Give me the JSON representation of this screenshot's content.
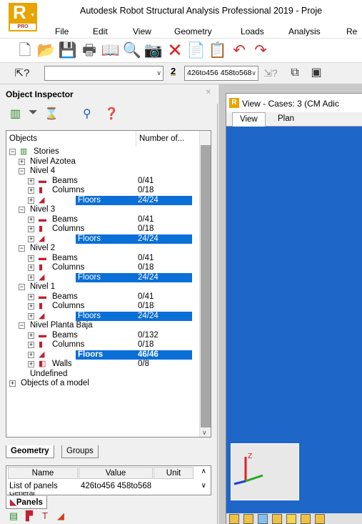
{
  "window": {
    "title": "Autodesk Robot Structural Analysis Professional 2019 - Proje",
    "logo_letter": "R",
    "logo_badge": "PRO"
  },
  "menu": [
    "File",
    "Edit",
    "View",
    "Geometry",
    "Loads",
    "Analysis",
    "Re"
  ],
  "toolbar2": {
    "combo1_value": "",
    "layer_number": "2",
    "selection_value": "426to456 458to568"
  },
  "inspector": {
    "title": "Object Inspector",
    "columns": [
      "Objects",
      "Number of..."
    ],
    "tree": [
      {
        "level": 0,
        "exp": "minus",
        "icon": "stories-icon",
        "label": "Stories",
        "count": ""
      },
      {
        "level": 1,
        "exp": "plus",
        "icon": "",
        "label": "Nivel Azotea",
        "count": ""
      },
      {
        "level": 1,
        "exp": "minus",
        "icon": "",
        "label": "Nivel 4",
        "count": ""
      },
      {
        "level": 2,
        "exp": "plus",
        "icon": "beam-icon",
        "label": "Beams",
        "count": "0/41"
      },
      {
        "level": 2,
        "exp": "plus",
        "icon": "column-icon",
        "label": "Columns",
        "count": "0/18"
      },
      {
        "level": 2,
        "exp": "plus",
        "icon": "floor-icon",
        "label": "Floors",
        "count": "24/24",
        "selected": true
      },
      {
        "level": 1,
        "exp": "minus",
        "icon": "",
        "label": "Nivel 3",
        "count": ""
      },
      {
        "level": 2,
        "exp": "plus",
        "icon": "beam-icon",
        "label": "Beams",
        "count": "0/41"
      },
      {
        "level": 2,
        "exp": "plus",
        "icon": "column-icon",
        "label": "Columns",
        "count": "0/18"
      },
      {
        "level": 2,
        "exp": "plus",
        "icon": "floor-icon",
        "label": "Floors",
        "count": "24/24",
        "selected": true
      },
      {
        "level": 1,
        "exp": "minus",
        "icon": "",
        "label": "Nivel 2",
        "count": ""
      },
      {
        "level": 2,
        "exp": "plus",
        "icon": "beam-icon",
        "label": "Beams",
        "count": "0/41"
      },
      {
        "level": 2,
        "exp": "plus",
        "icon": "column-icon",
        "label": "Columns",
        "count": "0/18"
      },
      {
        "level": 2,
        "exp": "plus",
        "icon": "floor-icon",
        "label": "Floors",
        "count": "24/24",
        "selected": true
      },
      {
        "level": 1,
        "exp": "minus",
        "icon": "",
        "label": "Nivel 1",
        "count": ""
      },
      {
        "level": 2,
        "exp": "plus",
        "icon": "beam-icon",
        "label": "Beams",
        "count": "0/41"
      },
      {
        "level": 2,
        "exp": "plus",
        "icon": "column-icon",
        "label": "Columns",
        "count": "0/18"
      },
      {
        "level": 2,
        "exp": "plus",
        "icon": "floor-icon",
        "label": "Floors",
        "count": "24/24",
        "selected": true
      },
      {
        "level": 1,
        "exp": "minus",
        "icon": "",
        "label": "Nivel Planta Baja",
        "count": ""
      },
      {
        "level": 2,
        "exp": "plus",
        "icon": "beam-icon",
        "label": "Beams",
        "count": "0/132"
      },
      {
        "level": 2,
        "exp": "plus",
        "icon": "column-icon",
        "label": "Columns",
        "count": "0/18"
      },
      {
        "level": 2,
        "exp": "plus",
        "icon": "floor-icon",
        "label": "Floors",
        "count": "46/46",
        "selected": true,
        "bold": true
      },
      {
        "level": 2,
        "exp": "plus",
        "icon": "wall-icon",
        "label": "Walls",
        "count": "0/8"
      },
      {
        "level": 1,
        "exp": "",
        "icon": "",
        "label": "Undefined",
        "count": ""
      },
      {
        "level": 0,
        "exp": "plus",
        "icon": "",
        "label": "Objects of a model",
        "count": ""
      }
    ],
    "tabs": [
      "Geometry",
      "Groups"
    ],
    "props": {
      "headers": [
        "Name",
        "Value",
        "Unit"
      ],
      "row": {
        "name": "List of panels",
        "value": "426to456 458to568",
        "unit": ""
      },
      "partial_row": "General"
    },
    "panels_tab": "Panels"
  },
  "view": {
    "title": "View - Cases: 3 (CM Adic",
    "tabs": [
      "View",
      "Plan"
    ],
    "axis_label": "Z",
    "canvas_color": "#1e66c8"
  }
}
